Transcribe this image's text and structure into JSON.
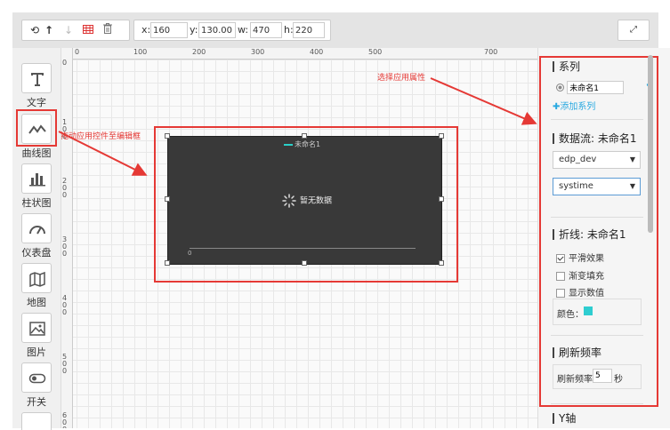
{
  "toolbar": {
    "coords": {
      "x_label": "x:",
      "x": "160",
      "y_label": "y:",
      "y": "130.00",
      "w_label": "w:",
      "w": "470",
      "h_label": "h:",
      "h": "220"
    },
    "icons": [
      "rotate-icon",
      "arrow-up-icon",
      "arrow-down-icon",
      "grid-icon",
      "trash-icon",
      "fullscreen-icon"
    ]
  },
  "components": [
    {
      "label": "文字",
      "icon": "text-icon"
    },
    {
      "label": "曲线图",
      "icon": "line-chart-icon"
    },
    {
      "label": "柱状图",
      "icon": "bar-chart-icon"
    },
    {
      "label": "仪表盘",
      "icon": "gauge-icon"
    },
    {
      "label": "地图",
      "icon": "map-icon"
    },
    {
      "label": "图片",
      "icon": "image-icon"
    },
    {
      "label": "开关",
      "icon": "switch-icon"
    }
  ],
  "ruler": {
    "horizontal": [
      "0",
      "100",
      "200",
      "300",
      "400",
      "500",
      "700"
    ],
    "vertical": [
      "0",
      "100",
      "200",
      "300",
      "400",
      "500",
      "600"
    ]
  },
  "widget": {
    "legend": "未命名1",
    "no_data": "暂无数据",
    "axis_zero": "0"
  },
  "annotations": {
    "drag": "拖动应用控件至编辑框",
    "select": "选择应用属性"
  },
  "properties": {
    "series_title": "系列",
    "series_name": "未命名1",
    "add_series": "✚添加系列",
    "datastream_title": "数据流: 未命名1",
    "device_select": "edp_dev",
    "stream_select": "systime",
    "polyline_title": "折线: 未命名1",
    "smooth": "平滑效果",
    "gradient": "渐变填充",
    "show_values": "显示数值",
    "color_label": "颜色：",
    "color_value": "#2ecdd0",
    "refresh_title": "刷新频率",
    "refresh_label": "刷新频率",
    "refresh_value": "5",
    "refresh_unit": "秒",
    "yaxis_title": "Y轴"
  },
  "colors": {
    "accent": "#e53935",
    "link": "#29a9e0",
    "widget_bg": "#393939"
  }
}
